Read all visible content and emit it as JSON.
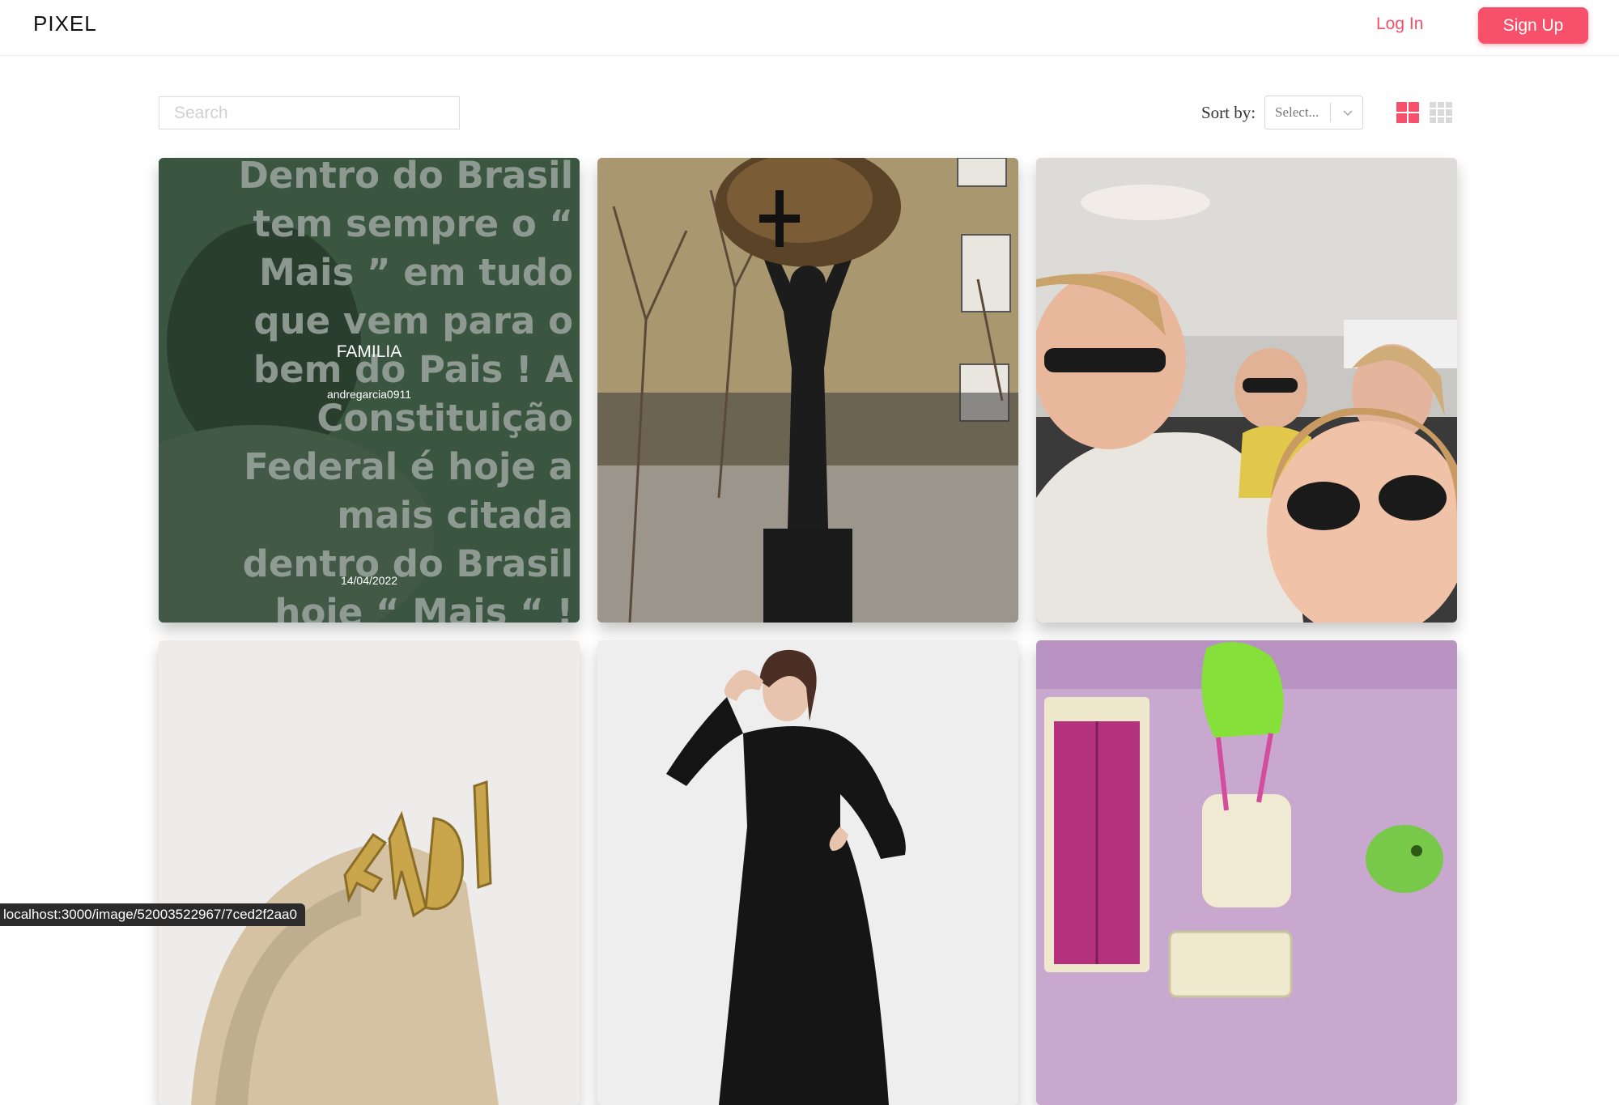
{
  "header": {
    "logo": "PIXEL",
    "login_label": "Log In",
    "signup_label": "Sign Up"
  },
  "toolbar": {
    "search_placeholder": "Search",
    "sort_label": "Sort by:",
    "sort_select_value": "Select...",
    "view_toggles": [
      {
        "name": "large-grid",
        "icon": "grid-2x2-icon",
        "active": true
      },
      {
        "name": "small-grid",
        "icon": "grid-3x3-icon",
        "active": false
      }
    ]
  },
  "gallery": {
    "cards": [
      {
        "image": "text-quote-over-portrait",
        "hovered": true,
        "image_text": "Dentro do Brasil\ntem sempre o “\nMais ” em tudo\nque vem para o\nbem do Pais ! A\nConstituição\nFederal é hoje a\nmais citada\ndentro do Brasil\nhoje “ Mais “ !",
        "title": "FAMILIA",
        "user": "andregarcia0911",
        "date": "14/04/2022"
      },
      {
        "image": "statue-holding-globe"
      },
      {
        "image": "car-selfie-friends"
      },
      {
        "image": "fendi-bag"
      },
      {
        "image": "woman-in-black-dress"
      },
      {
        "image": "pink-toy-furniture"
      }
    ]
  },
  "status_bar": {
    "url": "localhost:3000/image/52003522967/7ced2f2aa0"
  },
  "colors": {
    "accent": "#f7506a",
    "accent_text": "#f1516b",
    "toggle_inactive": "#d9d9d9"
  }
}
